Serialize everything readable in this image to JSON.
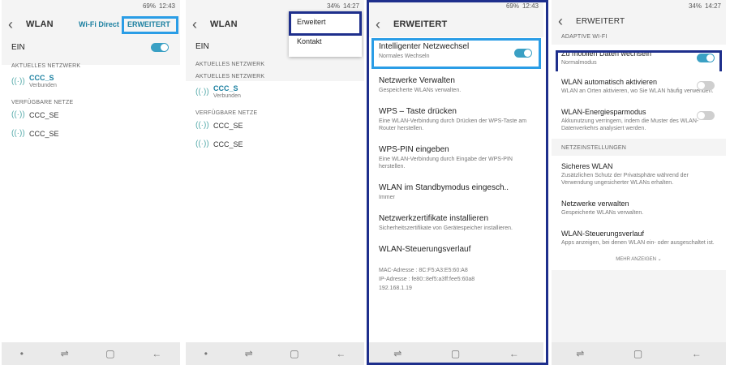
{
  "status": {
    "battery": "69%",
    "time": "12:43",
    "battery2": "34%",
    "time2": "14:27",
    "battery3": "69%",
    "time3": "12:43",
    "battery4": "34%",
    "time4": "14:27"
  },
  "p1": {
    "title": "WLAN",
    "wifi_direct": "Wi-Fi Direct",
    "erweitert": "ERWEITERT",
    "ein": "EIN",
    "sect_current": "AKTUELLES NETZWERK",
    "current_name": "CCC_S",
    "current_status": "Verbunden",
    "sect_available": "VERFÜGBARE NETZE",
    "avail": [
      "CCC_SE",
      "CCC_SE"
    ]
  },
  "p2": {
    "title": "WLAN",
    "ein": "EIN",
    "menu": [
      "Erweitert",
      "Kontakt"
    ],
    "sect_current": "AKTUELLES NETZWERK",
    "current_name": "CCC_S",
    "current_status": "Verbunden",
    "sect_available": "VERFÜGBARE NETZE",
    "avail": [
      "CCC_SE",
      "CCC_SE"
    ]
  },
  "p3": {
    "title": "ERWEITERT",
    "items": [
      {
        "t": "Intelligenter Netzwechsel",
        "s": "Normales Wechseln"
      },
      {
        "t": "Netzwerke Verwalten",
        "s": "Gespeicherte WLANs verwalten."
      },
      {
        "t": "WPS – Taste drücken",
        "s": "Eine WLAN-Verbindung durch Drücken der WPS-Taste am Router herstellen."
      },
      {
        "t": "WPS-PIN eingeben",
        "s": "Eine WLAN-Verbindung durch Eingabe der WPS-PIN herstellen."
      },
      {
        "t": "WLAN im Standbymodus eingesch..",
        "s": "Immer"
      },
      {
        "t": "Netzwerkzertifikate installieren",
        "s": "Sicherheitszertifikate von Gerätespeicher installieren."
      },
      {
        "t": "WLAN-Steuerungsverlauf",
        "s": ""
      }
    ],
    "mac": "MAC-Adresse : 8C:F5:A3:E5:60:A8",
    "ip": "IP-Adresse : fe80::8ef5:a3ff:fee5:60a8",
    "ip2": "192.168.1.19"
  },
  "p4": {
    "title": "ERWEITERT",
    "sect_adaptive": "ADAPTIVE WI-FI",
    "items_a": [
      {
        "t": "Zu mobilen Daten wechseln",
        "s": "Normalmodus"
      },
      {
        "t": "WLAN automatisch aktivieren",
        "s": "WLAN an Orten aktivieren, wo Sie WLAN häufig verwenden."
      },
      {
        "t": "WLAN-Energiesparmodus",
        "s": "Akkunutzung verringern, indem die Muster des WLAN-Datenverkehrs analysiert werden."
      }
    ],
    "sect_net": "NETZEINSTELLUNGEN",
    "items_b": [
      {
        "t": "Sicheres WLAN",
        "s": "Zusätzlichen Schutz der Privatsphäre während der Verwendung ungesicherter WLANs erhalten."
      },
      {
        "t": "Netzwerke verwalten",
        "s": "Gespeicherte WLANs verwalten."
      },
      {
        "t": "WLAN-Steuerungsverlauf",
        "s": "Apps anzeigen, bei denen WLAN ein- oder ausgeschaltet ist."
      }
    ],
    "more": "MEHR ANZEIGEN"
  }
}
